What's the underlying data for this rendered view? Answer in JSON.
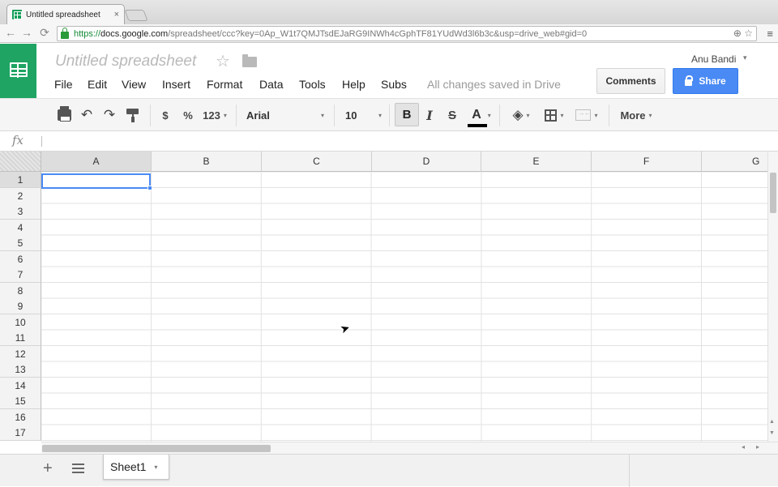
{
  "browser": {
    "tab_title": "Untitled spreadsheet",
    "tab_close": "×",
    "url_scheme": "https://",
    "url_host": "docs.google.com",
    "url_path": "/spreadsheet/ccc?key=0Ap_W1t7QMJTsdEJaRG9INWh4cGphTF81YUdWd3l6b3c&usp=drive_web#gid=0",
    "back": "←",
    "forward": "→",
    "reload": "⟳",
    "zoom_icon": "⊕",
    "star": "☆",
    "menu": "≡"
  },
  "header": {
    "title": "Untitled spreadsheet",
    "star": "☆",
    "user": "Anu Bandi",
    "user_caret": "▾",
    "save_status": "All changes saved in Drive",
    "comments_label": "Comments",
    "share_label": "Share"
  },
  "menu": [
    "File",
    "Edit",
    "View",
    "Insert",
    "Format",
    "Data",
    "Tools",
    "Help",
    "Subs"
  ],
  "toolbar": {
    "currency": "$",
    "percent": "%",
    "number_format": "123",
    "font": "Arial",
    "font_size": "10",
    "bold": "B",
    "italic": "I",
    "strikethrough": "S",
    "text_color": "A",
    "more": "More",
    "undo": "↶",
    "redo": "↷",
    "caret": "▾",
    "fill_icon": "◈"
  },
  "formula_bar": {
    "fx": "fx"
  },
  "grid": {
    "columns": [
      "A",
      "B",
      "C",
      "D",
      "E",
      "F",
      "G"
    ],
    "rows": [
      "1",
      "2",
      "3",
      "4",
      "5",
      "6",
      "7",
      "8",
      "9",
      "10",
      "11",
      "12",
      "13",
      "14",
      "15",
      "16",
      "17"
    ],
    "selected_cell": "A1"
  },
  "sheets": {
    "add": "+",
    "tab_label": "Sheet1",
    "caret": "▾"
  },
  "scroll": {
    "up": "▲",
    "down": "▼",
    "left": "◂",
    "right": "▸"
  },
  "colors": {
    "brand_green": "#1fa463",
    "share_blue": "#4a8af4",
    "selection": "#4a8af4"
  }
}
